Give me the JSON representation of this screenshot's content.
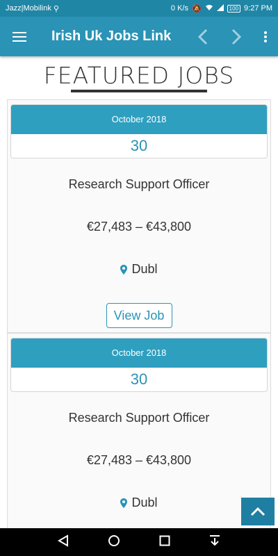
{
  "status_bar": {
    "carrier": "Jazz|Mobilink",
    "speed": "0 K/s",
    "battery": "100",
    "time": "9:27 PM"
  },
  "app_bar": {
    "title": "Irish Uk Jobs Link"
  },
  "section": {
    "heading": "FEATURED JOBS"
  },
  "jobs": [
    {
      "month": "October 2018",
      "day": "30",
      "title": "Research Support Officer",
      "salary": "€27,483 – €43,800",
      "location": "Dubl",
      "button_label": "View Job"
    },
    {
      "month": "October 2018",
      "day": "30",
      "title": "Research Support Officer",
      "salary": "€27,483 – €43,800",
      "location": "Dubl"
    }
  ],
  "colors": {
    "primary": "#2a93b6",
    "status_bar": "#1f86a6",
    "date_header": "#2f9fc0"
  }
}
